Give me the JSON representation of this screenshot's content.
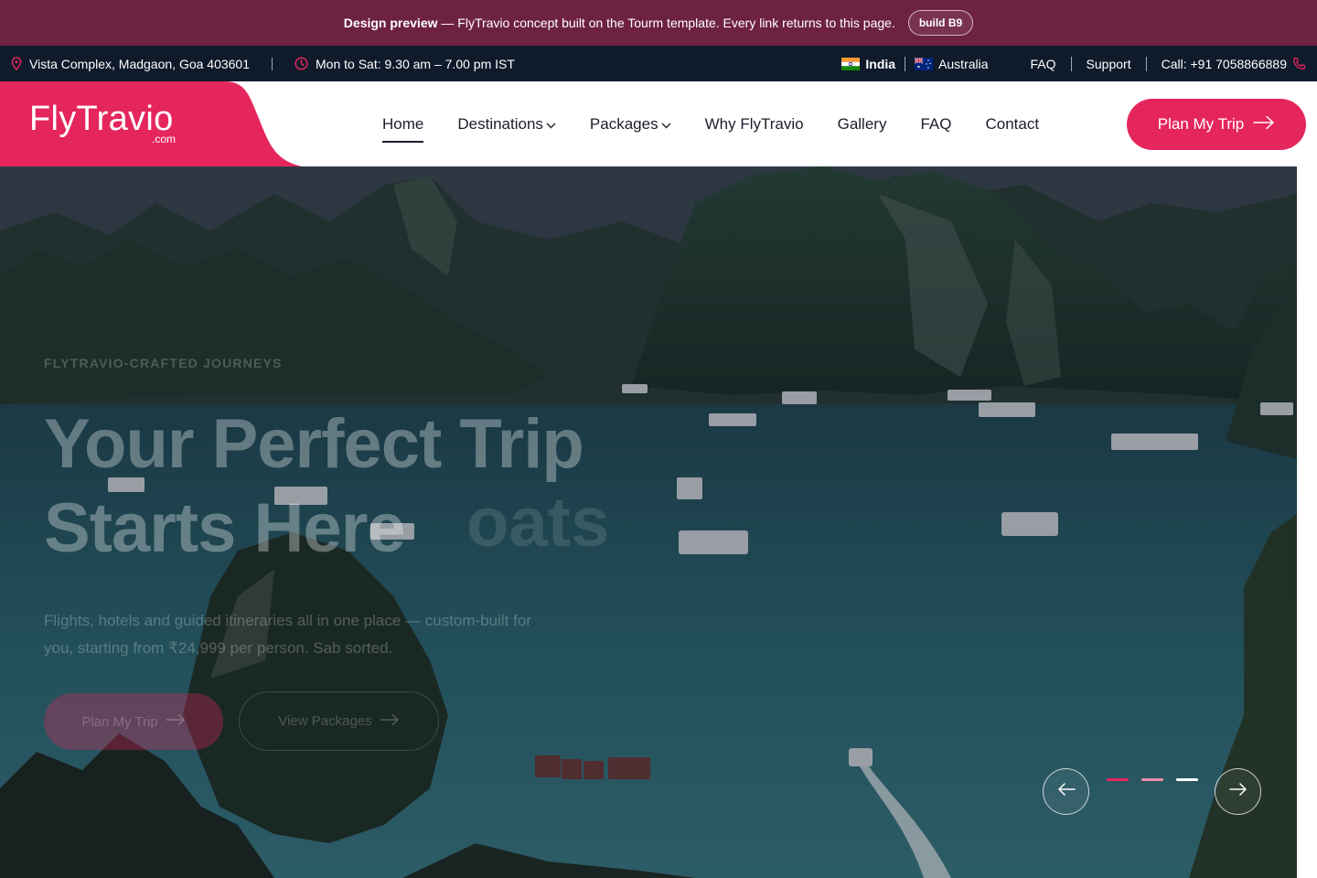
{
  "preview": {
    "bold": "Design preview",
    "text": "— FlyTravio concept built on the Tourm template. Every link returns to this page.",
    "build": "build B9"
  },
  "topbar": {
    "address": "Vista Complex, Madgaon, Goa 403601",
    "hours": "Mon to Sat: 9.30 am – 7.00 pm IST",
    "countries": [
      "India",
      "Australia"
    ],
    "links": [
      "FAQ",
      "Support"
    ],
    "call": "Call: +91 7058866889"
  },
  "header": {
    "logo_main": "FlyTravio",
    "logo_sub": ".com",
    "nav": [
      "Home",
      "Destinations",
      "Packages",
      "Why FlyTravio",
      "Gallery",
      "FAQ",
      "Contact"
    ],
    "cta": "Plan My Trip"
  },
  "hero": {
    "eyebrow": "FLYTRAVIO-CRAFTED JOURNEYS",
    "headline_line1": "Your Perfect Trip",
    "headline_line2": "Starts Here",
    "ghost": "oats",
    "subtext_line1": "Flights, hotels and guided itineraries all in one place — custom-built for",
    "subtext_line2": "you, starting from ₹24,999 per person. Sab sorted.",
    "btn_primary": "Plan My Trip",
    "btn_secondary": "View Packages"
  },
  "colors": {
    "brand": "#e5265d",
    "preview_bar": "#6e2242",
    "topbar": "#0f1a2b"
  }
}
